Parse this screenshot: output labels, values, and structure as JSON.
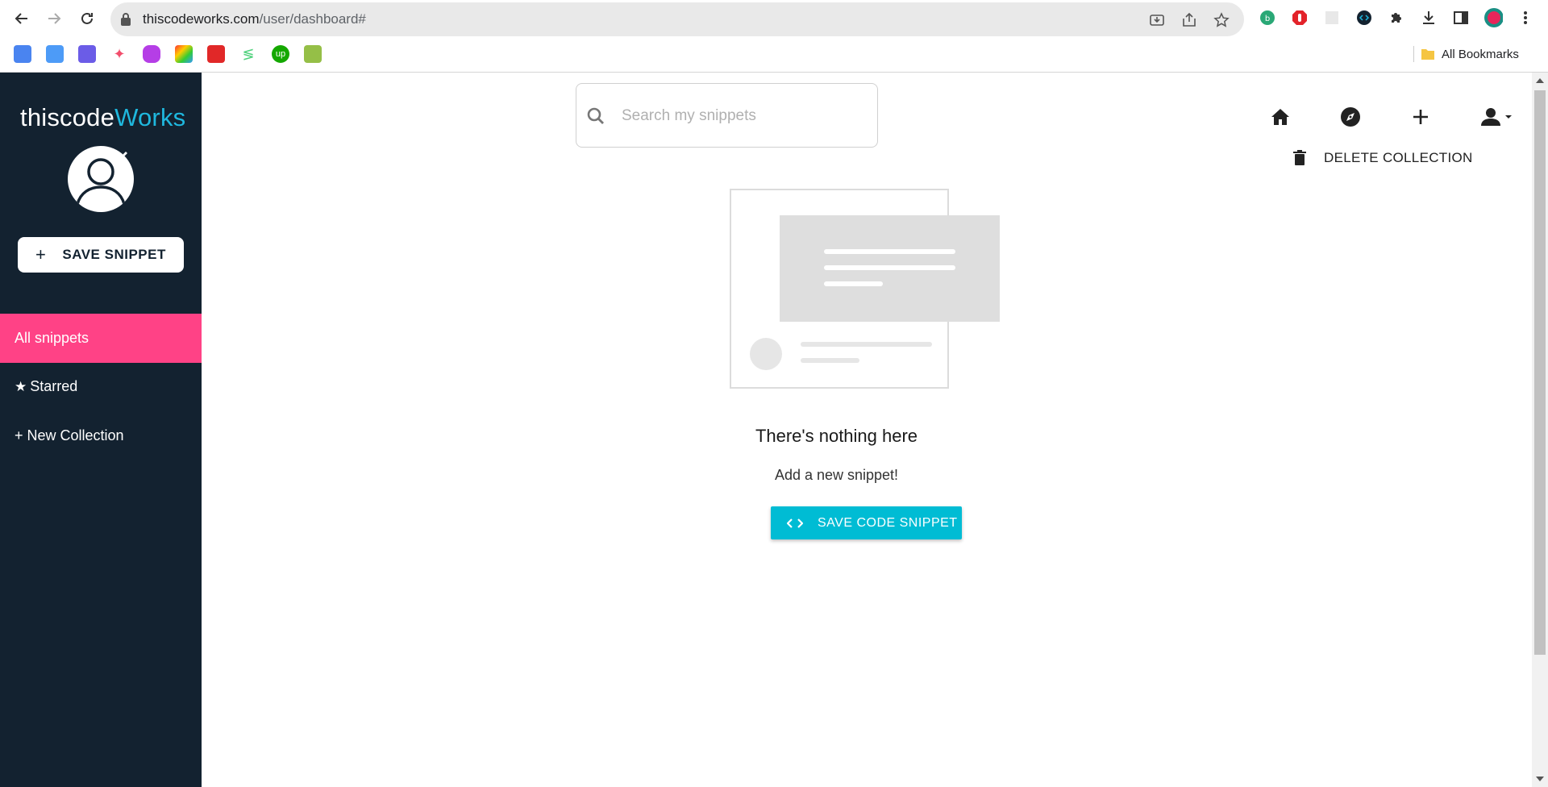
{
  "browser": {
    "url_host": "thiscodeworks.com",
    "url_path": "/user/dashboard#",
    "all_bookmarks_label": "All Bookmarks",
    "bookmarks": [
      "google-translate-icon",
      "calendar-icon",
      "app-store-icon",
      "figma-icon",
      "bot-icon",
      "photos-icon",
      "flipboard-icon",
      "upwork-leaf-icon",
      "upwork-icon",
      "shopify-icon"
    ],
    "extensions": [
      "grammar-extension-icon",
      "adblock-extension-icon",
      "blank-extension-icon",
      "code-extension-icon",
      "puzzle-extensions-icon",
      "downloads-icon",
      "side-panel-icon",
      "profile-icon",
      "menu-icon"
    ]
  },
  "sidebar": {
    "logo_part1": "thiscode",
    "logo_part2": "Works",
    "save_button_label": "SAVE SNIPPET",
    "items": [
      {
        "label": "All snippets",
        "active": true
      },
      {
        "label": "Starred",
        "icon": "★"
      },
      {
        "label": "+ New Collection"
      }
    ],
    "colors": {
      "background": "#132230",
      "active": "#ff4286",
      "accent": "#1fb8de"
    }
  },
  "header": {
    "search_placeholder": "Search my snippets",
    "delete_collection_label": "DELETE COLLECTION"
  },
  "empty_state": {
    "title": "There's nothing here",
    "subtitle": "Add a new snippet!",
    "button_label": "SAVE CODE SNIPPET",
    "button_color": "#00bcd4"
  }
}
